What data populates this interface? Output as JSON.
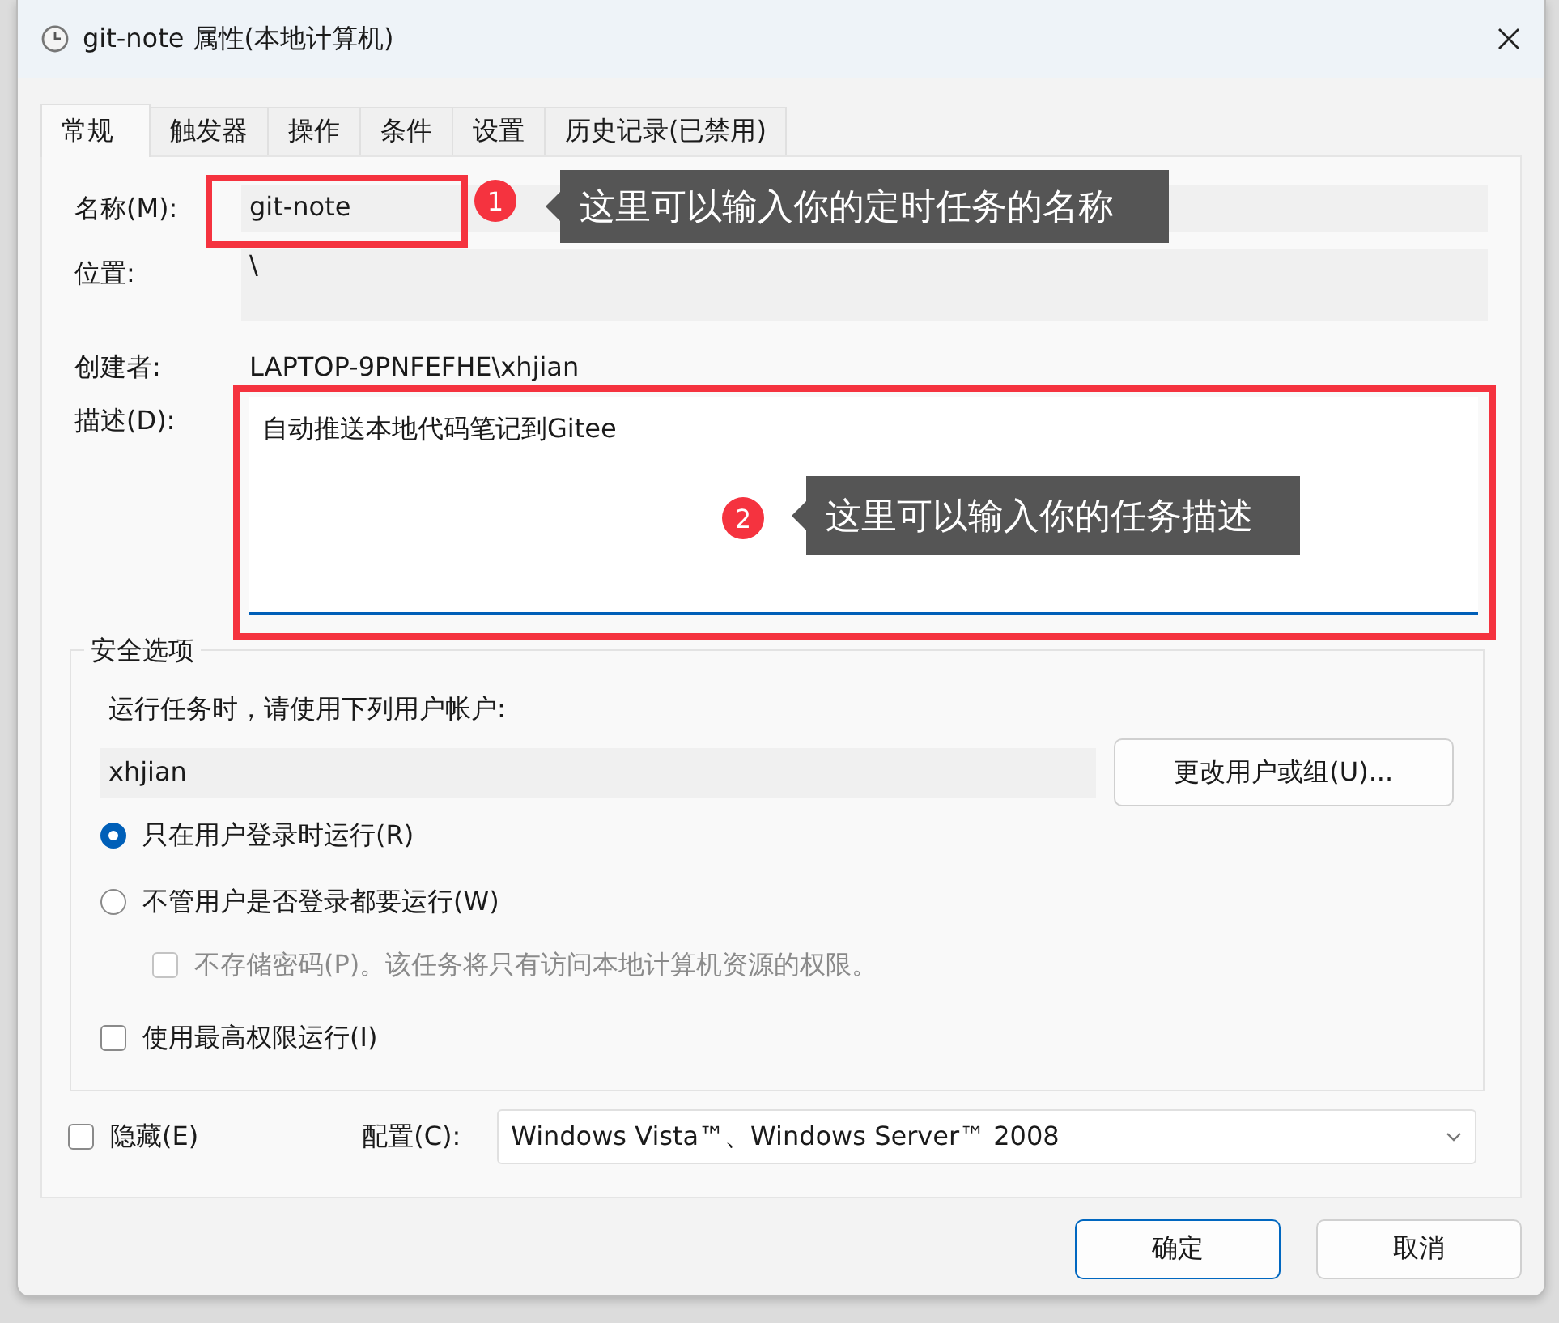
{
  "window": {
    "title": "git-note 属性(本地计算机)"
  },
  "tabs": [
    {
      "label": "常规",
      "selected": true
    },
    {
      "label": "触发器",
      "selected": false
    },
    {
      "label": "操作",
      "selected": false
    },
    {
      "label": "条件",
      "selected": false
    },
    {
      "label": "设置",
      "selected": false
    },
    {
      "label": "历史记录(已禁用)",
      "selected": false
    }
  ],
  "general": {
    "name_label": "名称(M):",
    "name_value": "git-note",
    "location_label": "位置:",
    "location_value": "\\",
    "author_label": "创建者:",
    "author_value": "LAPTOP-9PNFEFHE\\xhjian",
    "description_label": "描述(D):",
    "description_value": "自动推送本地代码笔记到Gitee"
  },
  "security": {
    "title": "安全选项",
    "account_prompt": "运行任务时，请使用下列用户帐户:",
    "account_value": "xhjian",
    "change_button": "更改用户或组(U)...",
    "options": [
      {
        "kind": "radio",
        "label": "只在用户登录时运行(R)",
        "selected": true,
        "disabled": false
      },
      {
        "kind": "radio",
        "label": "不管用户是否登录都要运行(W)",
        "selected": false,
        "disabled": false,
        "children": [
          {
            "kind": "checkbox",
            "label": "不存储密码(P)。该任务将只有访问本地计算机资源的权限。",
            "checked": false,
            "disabled": true
          }
        ]
      },
      {
        "kind": "checkbox",
        "label": "使用最高权限运行(I)",
        "checked": false,
        "disabled": false
      }
    ]
  },
  "hidden": {
    "label": "隐藏(E)",
    "checked": false
  },
  "config": {
    "label": "配置(C):",
    "value": "Windows Vista™、Windows Server™ 2008"
  },
  "buttons": [
    {
      "label": "确定",
      "default": true
    },
    {
      "label": "取消",
      "default": false
    }
  ],
  "annotations": [
    {
      "number": "1",
      "text": "这里可以输入你的定时任务的名称"
    },
    {
      "number": "2",
      "text": "这里可以输入你的任务描述"
    }
  ]
}
